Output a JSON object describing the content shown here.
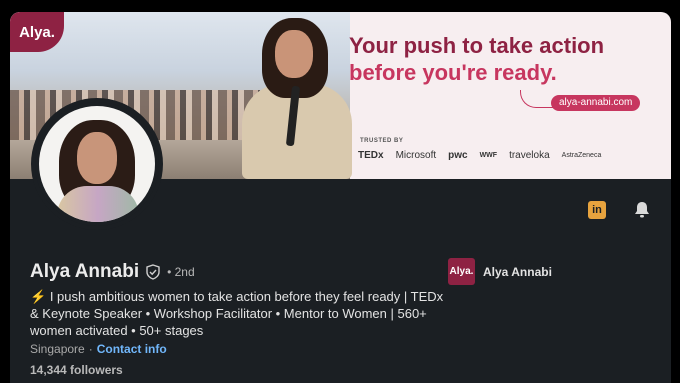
{
  "banner": {
    "brand_logo": "Alya.",
    "headline_line1": "Your push to take action",
    "headline_line2": "before you're ready.",
    "url": "alya-annabi.com",
    "trusted_by_label": "TRUSTED BY",
    "logos": [
      "TEDx",
      "Microsoft",
      "pwc",
      "WWF",
      "traveloka",
      "AstraZeneca"
    ]
  },
  "profile": {
    "name": "Alya Annabi",
    "degree": "• 2nd",
    "headline_icon": "⚡",
    "headline": "I push ambitious women to take action before they feel ready | TEDx & Keynote Speaker • Workshop Facilitator • Mentor to Women | 560+ women activated • 50+ stages",
    "location": "Singapore",
    "separator": "·",
    "contact_link": "Contact info",
    "followers": "14,344 followers"
  },
  "company": {
    "logo_text": "Alya.",
    "name": "Alya Annabi"
  },
  "actions": {
    "linkedin_icon": "in",
    "bell_icon": "bell-icon"
  },
  "colors": {
    "brand": "#8e2243",
    "accent_pink": "#c7365f",
    "link": "#71b7fb",
    "card_bg": "#1b1f23"
  }
}
